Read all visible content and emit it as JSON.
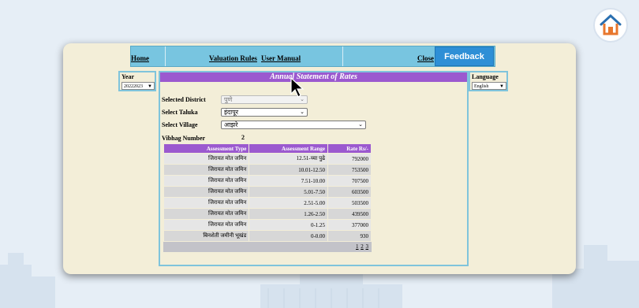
{
  "nav": {
    "home": "Home",
    "valuation_rules": "Valuation Rules",
    "user_manual": "User Manual",
    "close": "Close",
    "feedback": "Feedback"
  },
  "year": {
    "label": "Year",
    "value": "20222023"
  },
  "language": {
    "label": "Language",
    "value": "English"
  },
  "panel": {
    "title": "Annual Statement of Rates",
    "district_label": "Selected District",
    "district_value": "पुणे",
    "taluka_label": "Select Taluka",
    "taluka_value": "इंदापूर",
    "village_label": "Select Village",
    "village_value": "आझरे",
    "vibhag_label": "Vibhag Number",
    "vibhag_value": "2"
  },
  "table": {
    "headers": [
      "Assessment Type",
      "Assessment Range",
      "Rate Rs/-"
    ],
    "rows": [
      [
        "जिरायत मोत जमिन",
        "12.51-च्या पुढे",
        "792000"
      ],
      [
        "जिरायत मोत जमिन",
        "10.01-12.50",
        "753500"
      ],
      [
        "जिरायत मोत जमिन",
        "7.51-10.00",
        "707500"
      ],
      [
        "जिरायत मोत जमिन",
        "5.01-7.50",
        "603500"
      ],
      [
        "जिरायत मोत जमिन",
        "2.51-5.00",
        "503500"
      ],
      [
        "जिरायत मोत जमिन",
        "1.26-2.50",
        "439500"
      ],
      [
        "जिरायत मोत जमिन",
        "0-1.25",
        "377000"
      ],
      [
        "बिनशेती जमीनी भूखंड",
        "0-0.00",
        "930"
      ]
    ],
    "pages": [
      "1",
      "2",
      "3"
    ]
  },
  "colors": {
    "accent_purple": "#9b59cf",
    "nav_blue": "#78c5e0",
    "feedback_blue": "#2e8fd6",
    "card_bg": "#f3eed8"
  },
  "icons": {
    "logo": "house-logo-icon",
    "cursor": "mouse-pointer-icon",
    "dropdown": "chevron-down-icon"
  }
}
